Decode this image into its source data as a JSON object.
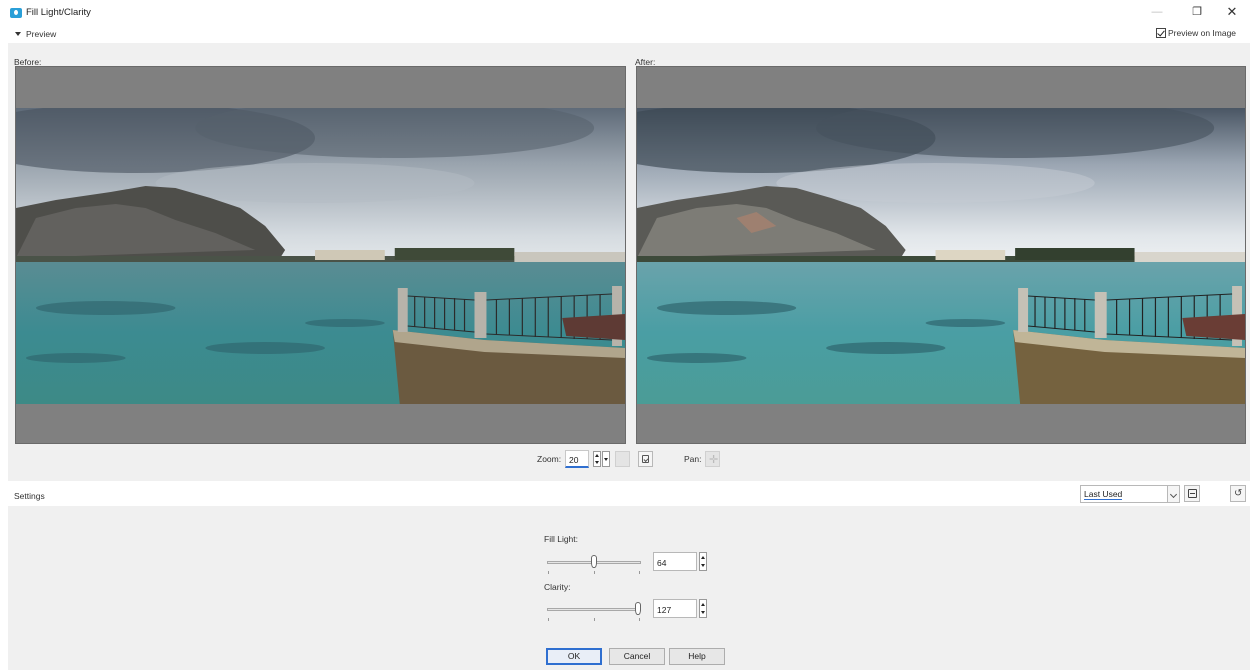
{
  "window": {
    "title": "Fill Light/Clarity",
    "minimize_glyph": "—",
    "maximize_glyph": "❐",
    "close_glyph": "✕"
  },
  "preview_section": {
    "toggle_label": "Preview",
    "preview_on_image_label": "Preview on Image",
    "preview_on_image_checked": true,
    "before_label": "Before:",
    "after_label": "After:"
  },
  "zoom": {
    "label": "Zoom:",
    "value": "20",
    "pan_label": "Pan:",
    "pan_icon": "✛"
  },
  "settings": {
    "label": "Settings",
    "preset_value": "Last Used",
    "reset_glyph": "↺"
  },
  "controls": {
    "fill_light": {
      "label": "Fill Light:",
      "value": "64",
      "fraction": 0.5
    },
    "clarity": {
      "label": "Clarity:",
      "value": "127",
      "fraction": 1.0
    }
  },
  "buttons": {
    "ok": "OK",
    "cancel": "Cancel",
    "help": "Help"
  },
  "colors": {
    "accent": "#2f6fd0",
    "panel_bg": "#f0f0f0",
    "preview_bg": "#808080"
  },
  "icons": {
    "app": "photo-app-icon",
    "save_preset": "save-disk-icon",
    "reset": "reset-icon",
    "fit": "fit-window-icon",
    "pan": "pan-move-icon"
  }
}
